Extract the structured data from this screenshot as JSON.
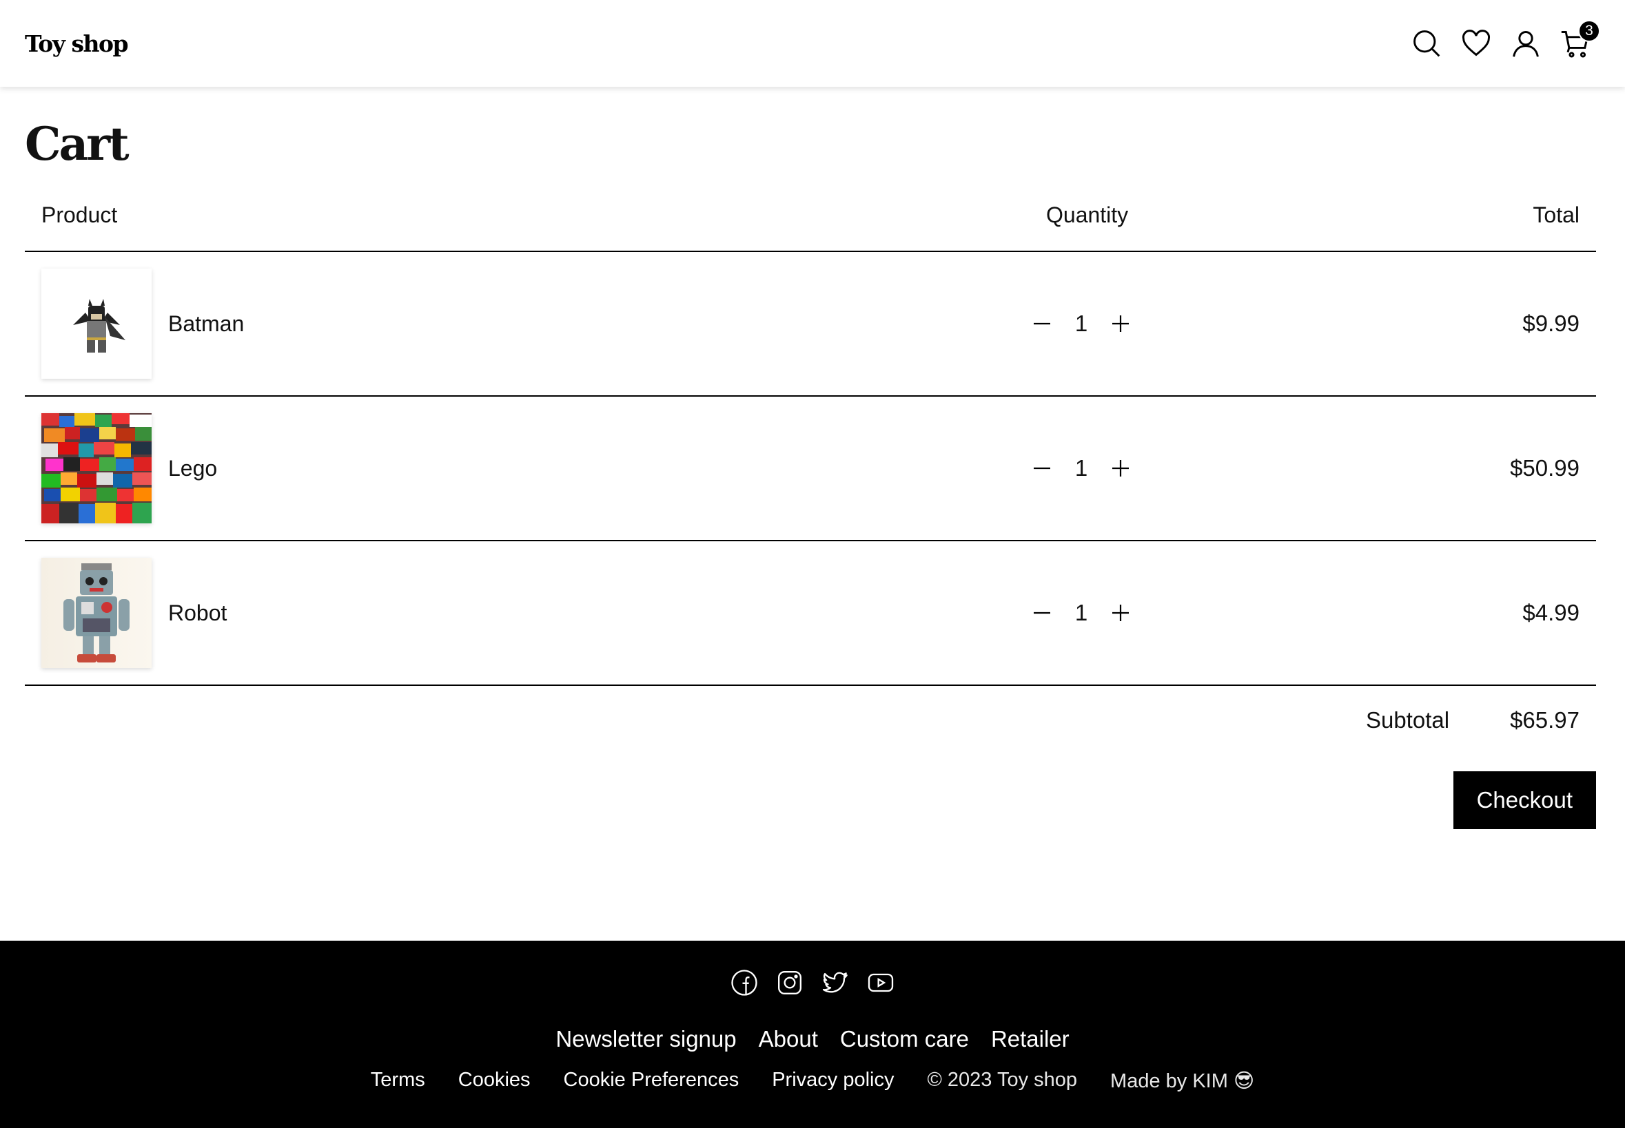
{
  "header": {
    "logo": "Toy shop",
    "cart_count": "3",
    "icons": [
      "search-icon",
      "heart-icon",
      "user-icon",
      "cart-icon"
    ]
  },
  "page": {
    "title": "Cart"
  },
  "table": {
    "headers": {
      "product": "Product",
      "quantity": "Quantity",
      "total": "Total"
    },
    "rows": [
      {
        "name": "Batman",
        "quantity": "1",
        "total": "$9.99",
        "image": "batman-image"
      },
      {
        "name": "Lego",
        "quantity": "1",
        "total": "$50.99",
        "image": "lego-image"
      },
      {
        "name": "Robot",
        "quantity": "1",
        "total": "$4.99",
        "image": "robot-image"
      }
    ]
  },
  "summary": {
    "subtotal_label": "Subtotal",
    "subtotal_value": "$65.97",
    "checkout_label": "Checkout"
  },
  "footer": {
    "socials": [
      "facebook-icon",
      "instagram-icon",
      "twitter-icon",
      "youtube-icon"
    ],
    "nav": [
      "Newsletter signup",
      "About",
      "Custom care",
      "Retailer"
    ],
    "legal": [
      "Terms",
      "Cookies",
      "Cookie Preferences",
      "Privacy policy"
    ],
    "copyright": "© 2023 Toy shop",
    "made_by": "Made by KIM 😎"
  }
}
